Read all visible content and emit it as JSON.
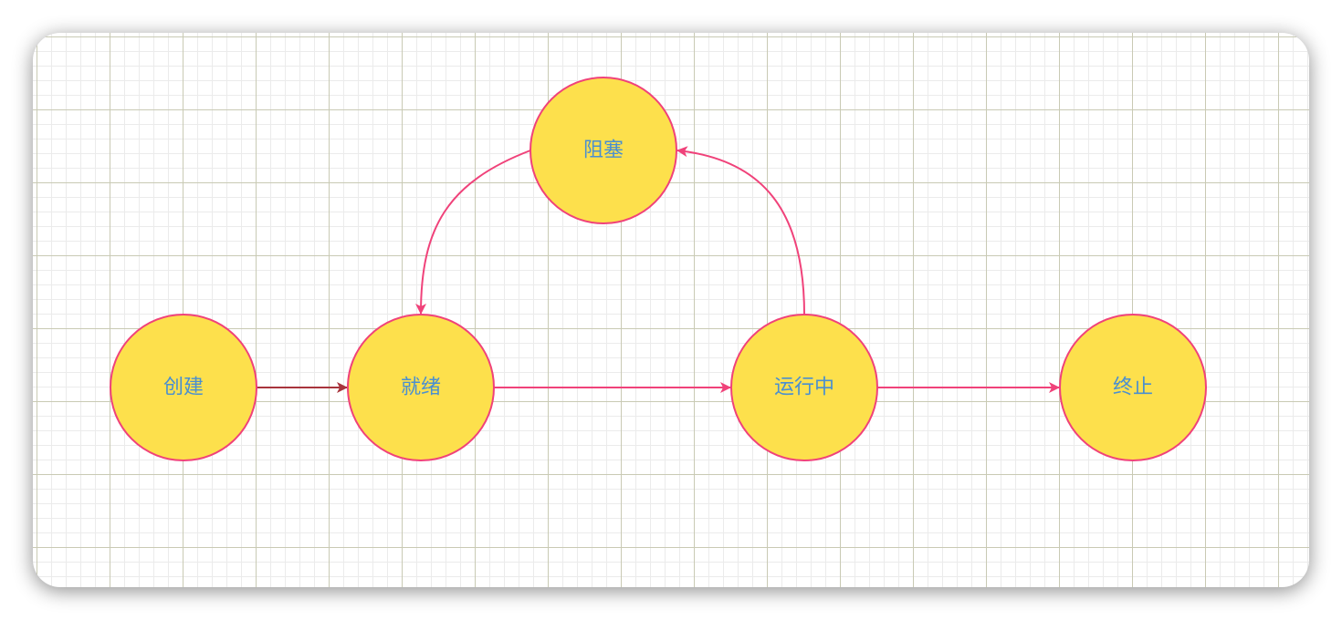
{
  "diagram": {
    "nodes": {
      "create": {
        "label": "创建"
      },
      "ready": {
        "label": "就绪"
      },
      "running": {
        "label": "运行中"
      },
      "blocked": {
        "label": "阻塞"
      },
      "terminated": {
        "label": "终止"
      }
    },
    "edges": [
      {
        "from": "create",
        "to": "ready"
      },
      {
        "from": "ready",
        "to": "running"
      },
      {
        "from": "running",
        "to": "terminated"
      },
      {
        "from": "running",
        "to": "blocked"
      },
      {
        "from": "blocked",
        "to": "ready"
      }
    ],
    "colors": {
      "node_fill": "#fde04c",
      "node_stroke": "#f0427a",
      "label_text": "#4a8fd0",
      "edge": "#f0427a",
      "edge_initial": "#a8343c",
      "grid_major": "#c9cab4",
      "grid_minor": "#ebebeb"
    }
  }
}
